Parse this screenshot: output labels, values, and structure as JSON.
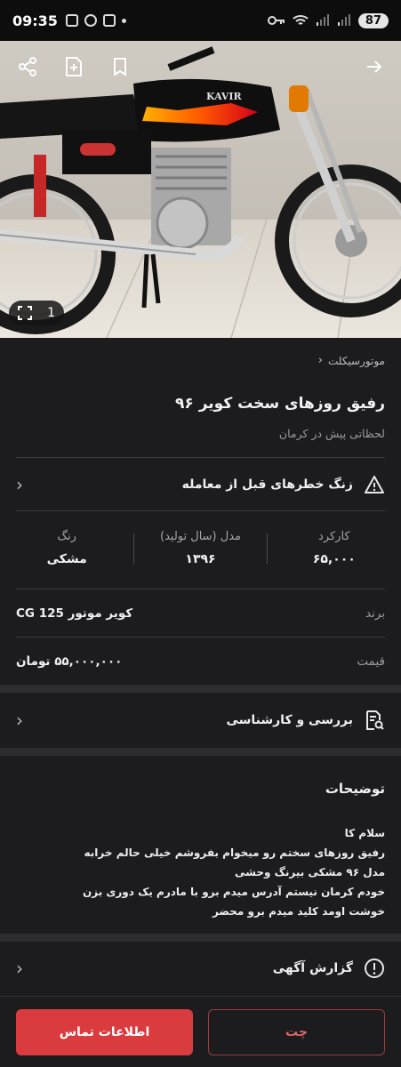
{
  "status_bar": {
    "time": "09:35",
    "battery": "87"
  },
  "gallery": {
    "image_counter": "1"
  },
  "breadcrumb": {
    "category": "موتورسیکلت"
  },
  "ad": {
    "title": "رفیق روزهای سخت کویر ۹۶",
    "meta": "لحظاتی پیش در کرمان"
  },
  "warning_row": {
    "label": "زنگ خطرهای قبل از معامله"
  },
  "stats": [
    {
      "label": "کارکرد",
      "value": "۶۵,۰۰۰"
    },
    {
      "label": "مدل (سال تولید)",
      "value": "۱۳۹۶"
    },
    {
      "label": "رنگ",
      "value": "مشکی"
    }
  ],
  "details": [
    {
      "key": "برند",
      "value": "کویر موتور CG 125"
    },
    {
      "key": "قیمت",
      "value": "۵۵,۰۰۰,۰۰۰ تومان"
    }
  ],
  "review_row": {
    "label": "بررسی و کارشناسی"
  },
  "description": {
    "title": "توضیحات",
    "lines": [
      "سلام کا",
      "رفیق روزهای سختم رو میخوام بفروشم خیلی حالم خرابه",
      "مدل ۹۶ مشکی بیرنگ وحشی",
      "خودم کرمان نیستم آدرس میدم برو با مادرم یک دوری بزن",
      "خوشت اومد کلید میدم برو محضر"
    ]
  },
  "report_row": {
    "label": "گزارش آگهی"
  },
  "actions": {
    "contact_label": "اطلاعات تماس",
    "chat_label": "چت"
  },
  "colors": {
    "accent": "#d93b3f",
    "background": "#1c1c1e"
  }
}
